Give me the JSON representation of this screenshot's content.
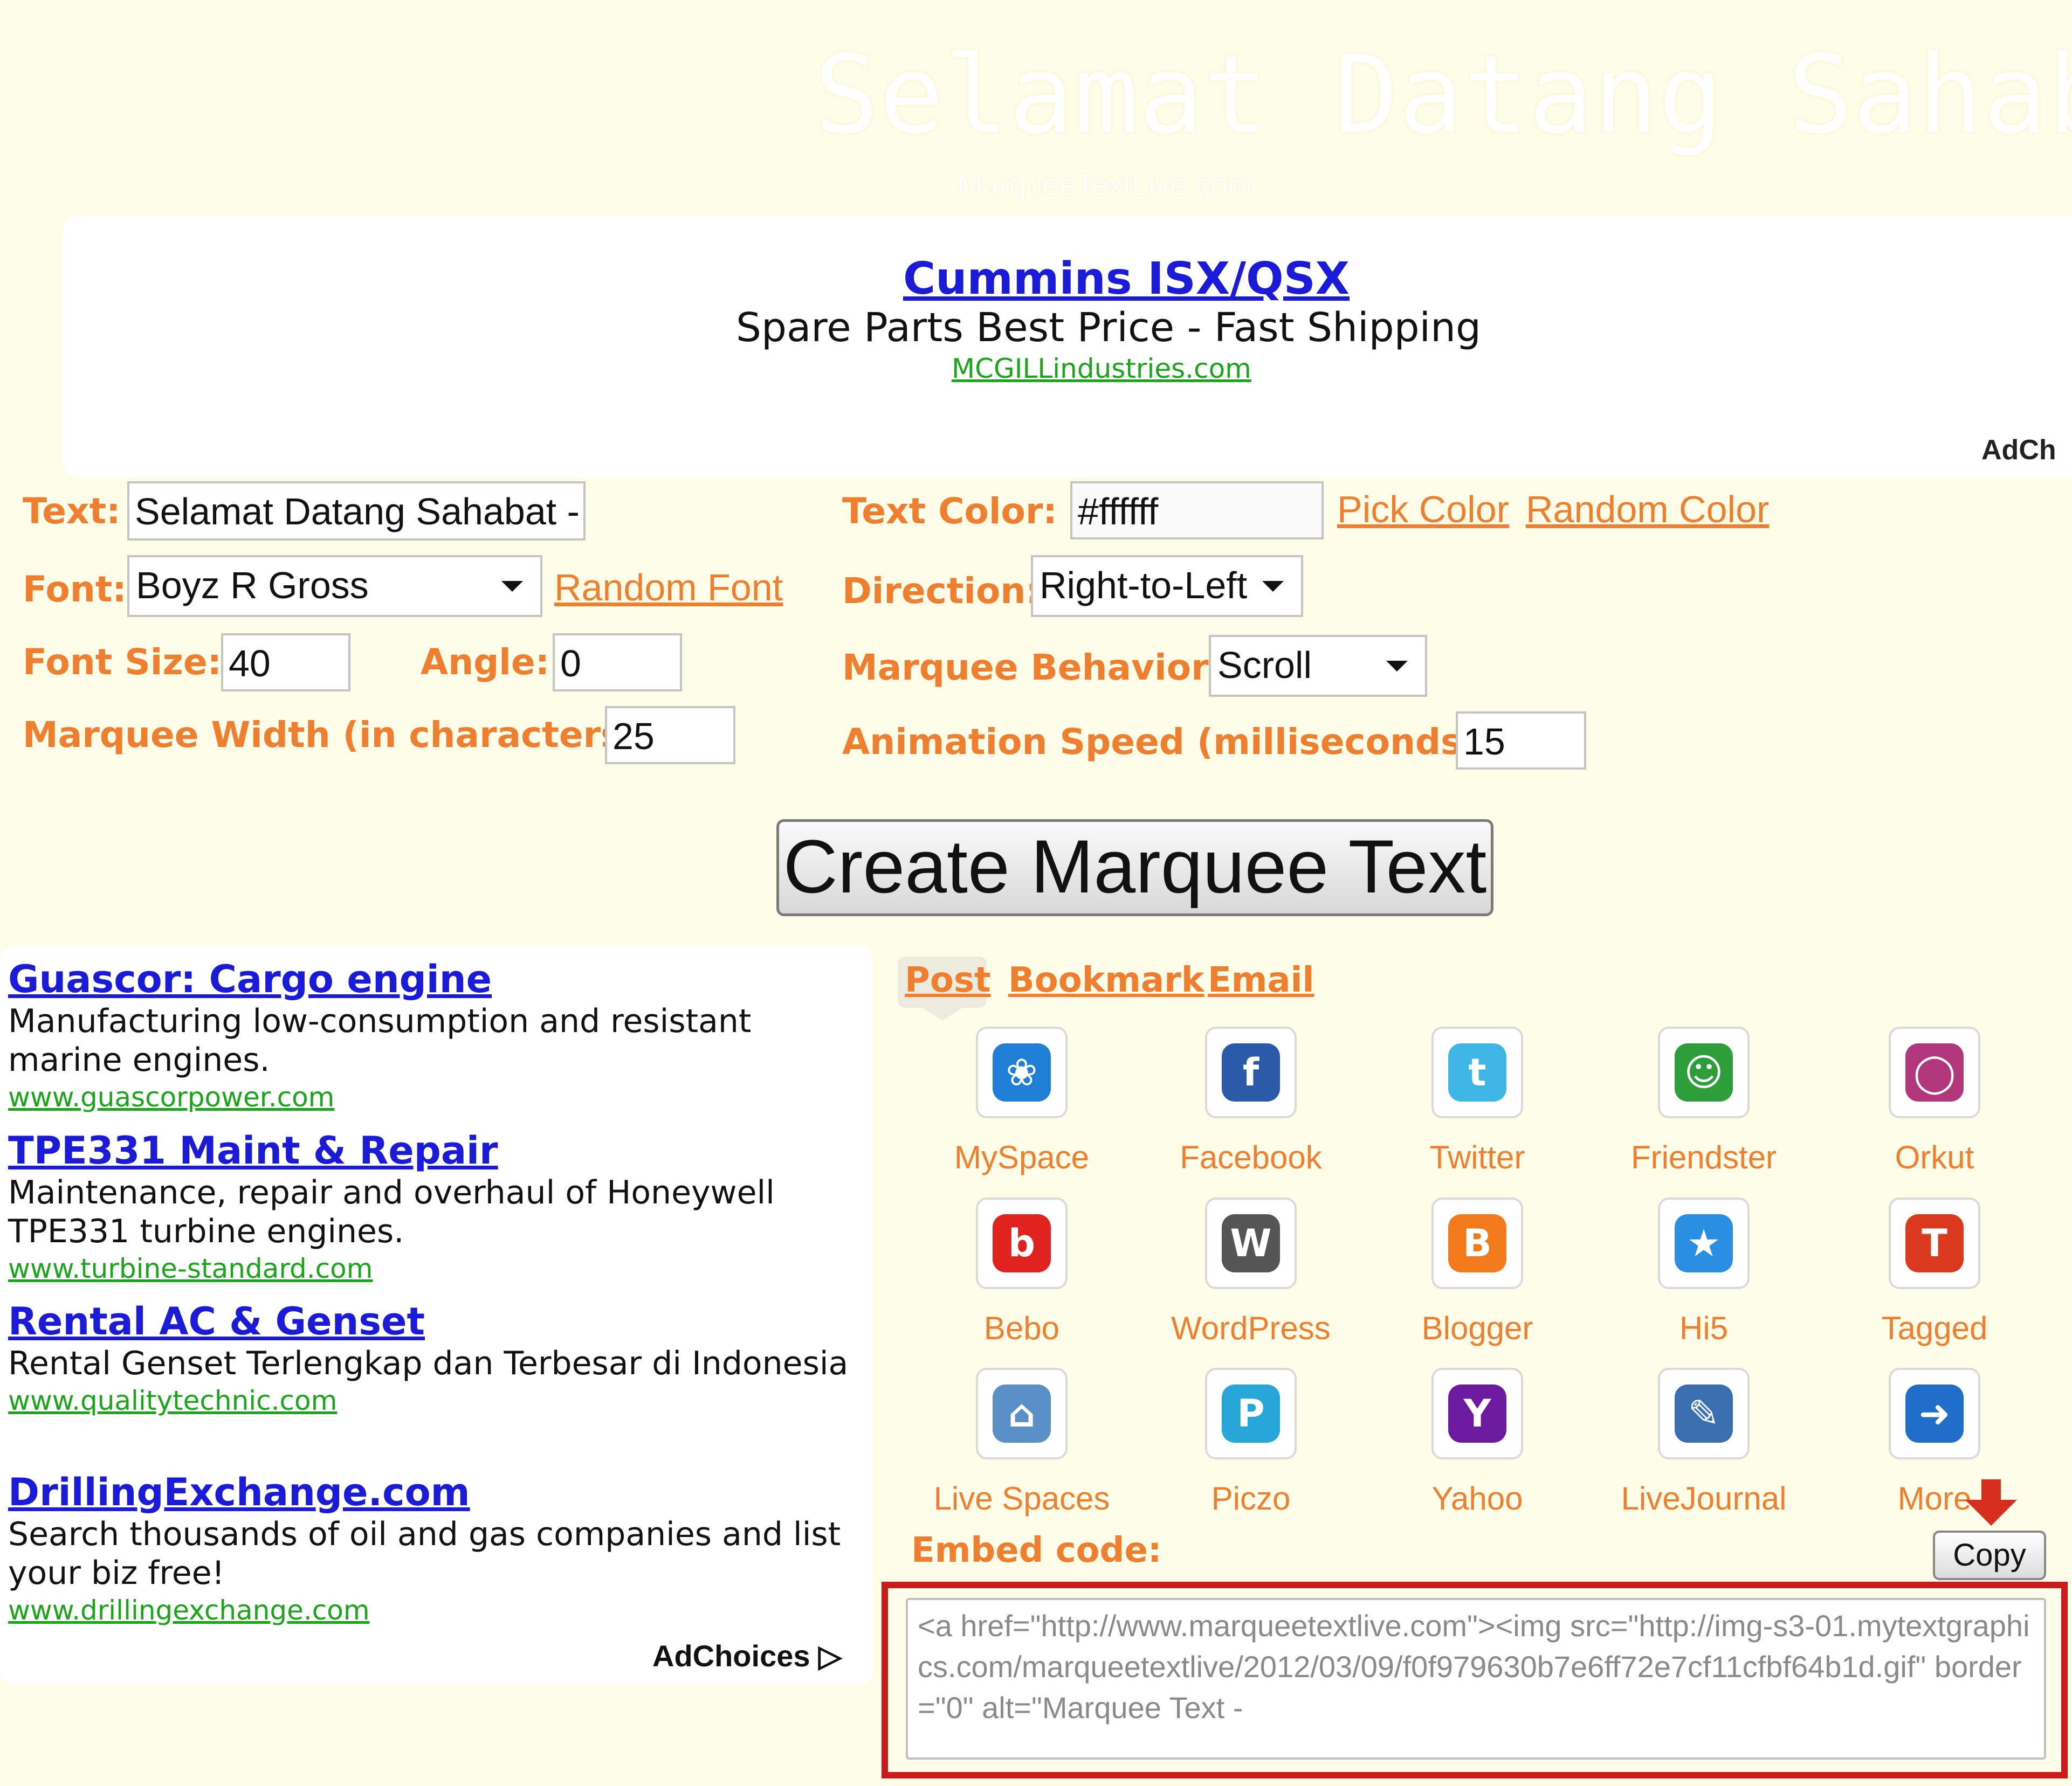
{
  "colors": {
    "page_bg": "#fdfde8",
    "accent_orange": "#ef7f2e",
    "ad_link_blue": "#1a1ad9",
    "ad_url_green": "#1aa51a",
    "highlight_red": "#cc1b1b"
  },
  "header": {
    "top_cut_text": "· · · · · · ·",
    "preview_text": "Selamat Datang Sahab",
    "preview_credit": "MarqueeTextLive.com"
  },
  "top_ad": {
    "title": "Cummins ISX/QSX",
    "description": "Spare Parts Best Price - Fast Shipping",
    "url": "MCGILLindustries.com",
    "adchoices": "AdCh"
  },
  "form": {
    "text_label": "Text:",
    "text_value": "Selamat Datang Sahabat -",
    "font_label": "Font:",
    "font_value": "Boyz R Gross",
    "random_font": "Random Font",
    "font_size_label": "Font Size:",
    "font_size_value": "40",
    "angle_label": "Angle:",
    "angle_value": "0",
    "marquee_width_label": "Marquee Width (in characters):",
    "marquee_width_value": "25",
    "text_color_label": "Text Color:",
    "text_color_value": "#ffffff",
    "pick_color": "Pick Color",
    "random_color": "Random Color",
    "direction_label": "Direction:",
    "direction_value": "Right-to-Left",
    "behavior_label": "Marquee Behavior:",
    "behavior_value": "Scroll",
    "speed_label": "Animation Speed (milliseconds):",
    "speed_value": "15",
    "create_button": "Create Marquee Text"
  },
  "left_ads": {
    "items": [
      {
        "title": "Guascor: Cargo engine",
        "desc": "Manufacturing low-consumption and resistant marine engines.",
        "url": "www.guascorpower.com"
      },
      {
        "title": "TPE331 Maint & Repair",
        "desc": "Maintenance, repair and overhaul of Honeywell TPE331 turbine engines.",
        "url": "www.turbine-standard.com"
      },
      {
        "title": "Rental AC & Genset",
        "desc": "Rental Genset Terlengkap dan Terbesar di Indonesia",
        "url": "www.qualitytechnic.com"
      },
      {
        "title": "DrillingExchange.com",
        "desc": "Search thousands of oil and gas companies and list your biz free!",
        "url": "www.drillingexchange.com"
      }
    ],
    "adchoices": "AdChoices ▷"
  },
  "share": {
    "tabs": [
      "Post",
      "Bookmark",
      "Email"
    ],
    "services": [
      {
        "name": "MySpace",
        "icon": "myspace-icon",
        "color": "#1f7fd6",
        "glyph": "❀"
      },
      {
        "name": "Facebook",
        "icon": "facebook-icon",
        "color": "#2b5ba8",
        "glyph": "f"
      },
      {
        "name": "Twitter",
        "icon": "twitter-icon",
        "color": "#3fb6e6",
        "glyph": "t"
      },
      {
        "name": "Friendster",
        "icon": "friendster-icon",
        "color": "#2e9e3a",
        "glyph": "☺"
      },
      {
        "name": "Orkut",
        "icon": "orkut-icon",
        "color": "#b2367a",
        "glyph": "◯"
      },
      {
        "name": "Bebo",
        "icon": "bebo-icon",
        "color": "#e0231e",
        "glyph": "b"
      },
      {
        "name": "WordPress",
        "icon": "wordpress-icon",
        "color": "#555555",
        "glyph": "W"
      },
      {
        "name": "Blogger",
        "icon": "blogger-icon",
        "color": "#f27a1a",
        "glyph": "B"
      },
      {
        "name": "Hi5",
        "icon": "hi5-icon",
        "color": "#2a8fe0",
        "glyph": "★"
      },
      {
        "name": "Tagged",
        "icon": "tagged-icon",
        "color": "#d93a1e",
        "glyph": "T"
      },
      {
        "name": "Live Spaces",
        "icon": "live-spaces-icon",
        "color": "#5a8fc8",
        "glyph": "⌂"
      },
      {
        "name": "Piczo",
        "icon": "piczo-icon",
        "color": "#27a6d8",
        "glyph": "P"
      },
      {
        "name": "Yahoo",
        "icon": "yahoo-icon",
        "color": "#6d1b9e",
        "glyph": "Y"
      },
      {
        "name": "LiveJournal",
        "icon": "livejournal-icon",
        "color": "#3a6fb0",
        "glyph": "✎"
      },
      {
        "name": "More",
        "icon": "more-arrow-icon",
        "color": "#1f6fc8",
        "glyph": "➜"
      }
    ],
    "embed_label": "Embed code:",
    "copy_button": "Copy",
    "embed_code": "<a href=\"http://www.marqueetextlive.com\"><img src=\"http://img-s3-01.mytextgraphics.com/marqueetextlive/2012/03/09/f0f979630b7e6ff72e7cf11cfbf64b1d.gif\" border=\"0\" alt=\"Marquee Text -"
  }
}
